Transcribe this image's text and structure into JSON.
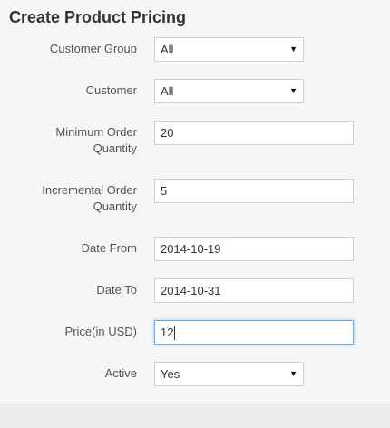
{
  "form": {
    "title": "Create Product Pricing",
    "customer_group": {
      "label": "Customer Group",
      "value": "All"
    },
    "customer": {
      "label": "Customer",
      "value": "All"
    },
    "min_order_qty": {
      "label_line1": "Minimum Order",
      "label_line2": "Quantity",
      "value": "20"
    },
    "incremental_order_qty": {
      "label_line1": "Incremental Order",
      "label_line2": "Quantity",
      "value": "5"
    },
    "date_from": {
      "label": "Date From",
      "value": "2014-10-19"
    },
    "date_to": {
      "label": "Date To",
      "value": "2014-10-31"
    },
    "price": {
      "label": "Price(in USD)",
      "value": "12"
    },
    "active": {
      "label": "Active",
      "value": "Yes"
    }
  },
  "icons": {
    "select_arrow": "caret-down-icon",
    "arrow_glyph": "▼"
  },
  "colors": {
    "focus_border": "#66afe9",
    "background": "#f6f6f6"
  }
}
